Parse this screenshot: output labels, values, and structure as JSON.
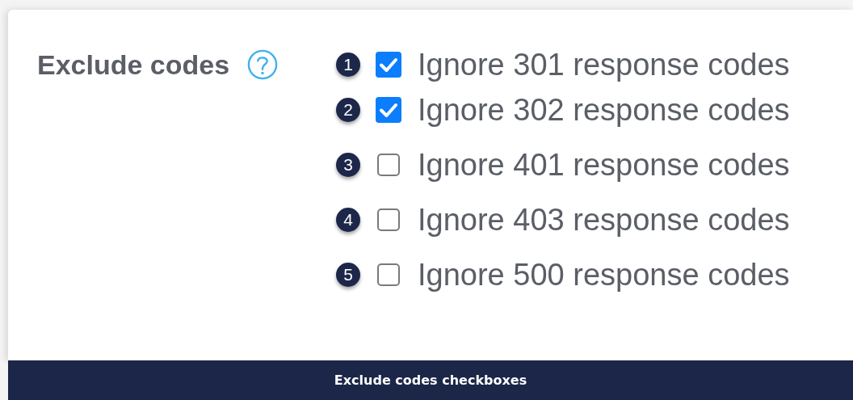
{
  "field": {
    "label": "Exclude codes"
  },
  "options": [
    {
      "marker": "1",
      "label": "Ignore 301 response codes",
      "checked": true
    },
    {
      "marker": "2",
      "label": "Ignore 302 response codes",
      "checked": true
    },
    {
      "marker": "3",
      "label": "Ignore 401 response codes",
      "checked": false
    },
    {
      "marker": "4",
      "label": "Ignore 403 response codes",
      "checked": false
    },
    {
      "marker": "5",
      "label": "Ignore 500 response codes",
      "checked": false
    }
  ],
  "caption": "Exclude codes checkboxes"
}
